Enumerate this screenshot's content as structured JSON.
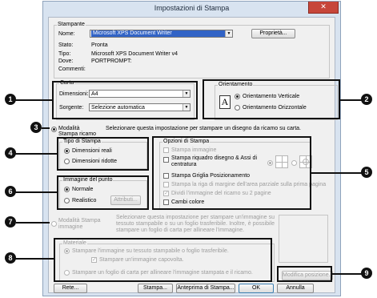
{
  "window": {
    "title": "Impostazioni di Stampa",
    "close_glyph": "✕"
  },
  "printer": {
    "legend": "Stampante",
    "name_label": "Nome:",
    "name_value": "Microsoft XPS Document Writer",
    "properties_button": "Proprietà...",
    "status_label": "Stato:",
    "status_value": "Pronta",
    "type_label": "Tipo:",
    "type_value": "Microsoft XPS Document Writer v4",
    "where_label": "Dove:",
    "where_value": "PORTPROMPT:",
    "comment_label": "Commenti:",
    "comment_value": ""
  },
  "paper": {
    "legend": "Carta",
    "size_label": "Dimensioni:",
    "size_value": "A4",
    "source_label": "Sorgente:",
    "source_value": "Selezione automatica"
  },
  "orientation": {
    "legend": "Orientamento",
    "page_glyph": "A",
    "options": [
      "Orientamento Verticale",
      "Orientamento Orizzontale"
    ],
    "selected": 0
  },
  "mode_embroidery": {
    "label": "Modalità Stampa ricamo",
    "description": "Selezionare questa impostazione per stampare un disegno da ricamo su carta."
  },
  "print_type": {
    "legend": "Tipo di Stampa",
    "options": [
      "Dimensioni reali",
      "Dimensioni ridotte"
    ],
    "selected": 0
  },
  "print_options": {
    "legend": "Opzioni di Stampa",
    "items": [
      {
        "label": "Stampa immagine",
        "enabled": false,
        "checked": false
      },
      {
        "label": "Stampa riquadro disegno & Assi di centratura",
        "enabled": true,
        "checked": false
      },
      {
        "label": "Stampa Griglia Posizionamento",
        "enabled": true,
        "checked": false
      },
      {
        "label": "Stampa la riga di margine dell'area parziale sulla prima pagina",
        "enabled": false,
        "checked": false
      },
      {
        "label": "Dividi l'immagine del ricamo su 2 pagine",
        "enabled": false,
        "checked": true
      },
      {
        "label": "Cambi colore",
        "enabled": true,
        "checked": false
      }
    ],
    "axis_style_icons": [
      "grid-cross-icon",
      "grid-cross-circle-icon"
    ]
  },
  "point_image": {
    "legend": "Immagine del punto",
    "options": [
      "Normale",
      "Realistico"
    ],
    "selected": 0,
    "attributes_button": "Attributi..."
  },
  "mode_image": {
    "label": "Modalità Stampa immagine",
    "description": "Selezionare questa impostazione per stampare un'immagine su tessuto stampabile o su un foglio trasferibile. Inoltre, è possibile stampare un foglio di carta per allineare l'immagine."
  },
  "material": {
    "legend": "Materiale",
    "option1": "Stampare l'immagine su tessuto stampabile o foglio trasferibile.",
    "mirror_label": "Stampare un'immagine capovolta.",
    "option2": "Stampare un foglio di carta per allineare l'immagine stampata e il ricamo."
  },
  "buttons": {
    "modify_position": "Modifica posizione...",
    "network": "Rete...",
    "print": "Stampa...",
    "preview": "Anteprima di Stampa...",
    "ok": "OK",
    "cancel": "Annulla"
  },
  "callouts": [
    "1",
    "2",
    "3",
    "4",
    "5",
    "6",
    "7",
    "8",
    "9"
  ]
}
